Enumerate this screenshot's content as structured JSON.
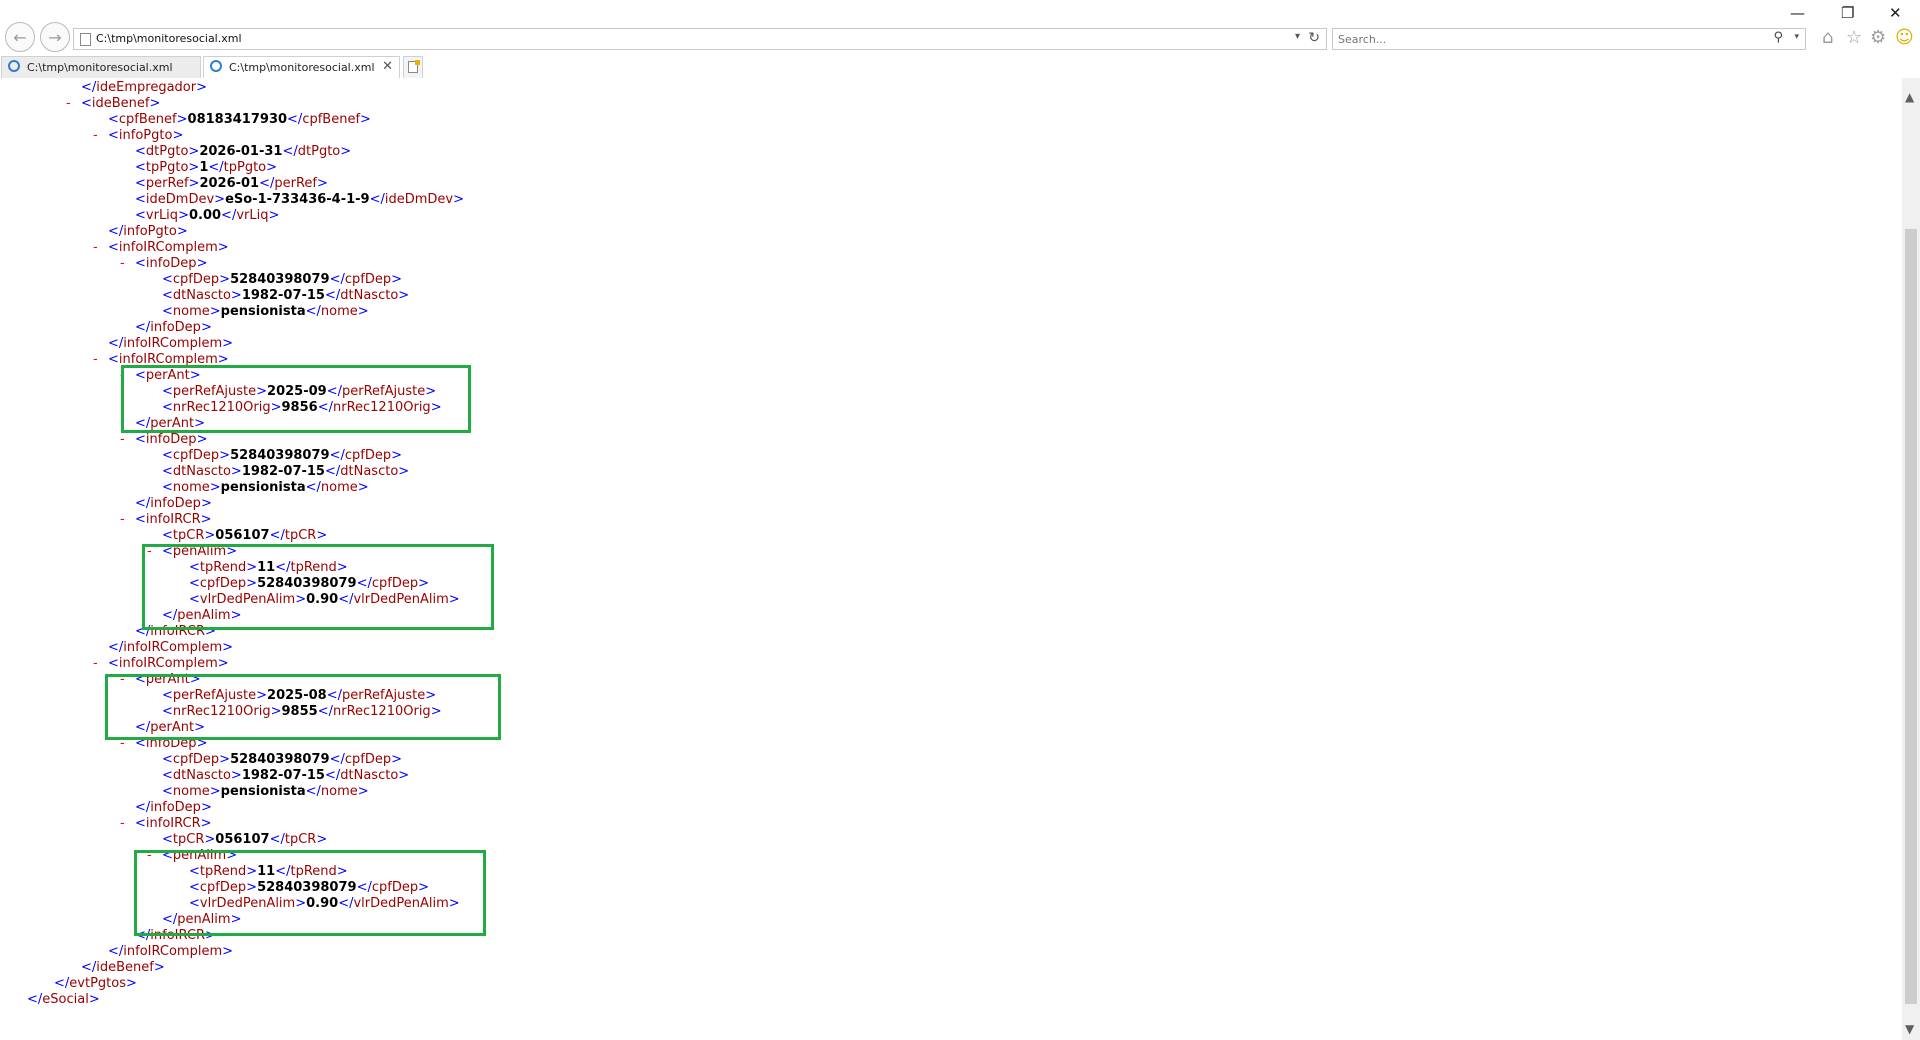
{
  "window": {
    "address": "C:\\tmp\\monitoresocial.xml",
    "search_placeholder": "Search...",
    "tabs": [
      {
        "label": "C:\\tmp\\monitoresocial.xml",
        "active": false
      },
      {
        "label": "C:\\tmp\\monitoresocial.xml",
        "active": true
      }
    ],
    "controls": {
      "close": "✕",
      "restore": "❐",
      "minimize": "—"
    },
    "icons": [
      "back-icon",
      "forward-icon",
      "refresh-icon",
      "search-icon",
      "home-icon",
      "star-icon",
      "gear-icon",
      "smiley-icon"
    ]
  },
  "xml_lines": [
    {
      "depth": 3,
      "kind": "close",
      "tag": "ideEmpregador"
    },
    {
      "depth": 3,
      "kind": "open",
      "tag": "ideBenef",
      "minus": true
    },
    {
      "depth": 4,
      "kind": "leaf",
      "tag": "cpfBenef",
      "value": "08183417930"
    },
    {
      "depth": 4,
      "kind": "open",
      "tag": "infoPgto",
      "minus": true
    },
    {
      "depth": 5,
      "kind": "leaf",
      "tag": "dtPgto",
      "value": "2026-01-31"
    },
    {
      "depth": 5,
      "kind": "leaf",
      "tag": "tpPgto",
      "value": "1"
    },
    {
      "depth": 5,
      "kind": "leaf",
      "tag": "perRef",
      "value": "2026-01"
    },
    {
      "depth": 5,
      "kind": "leaf",
      "tag": "ideDmDev",
      "value": "eSo-1-733436-4-1-9"
    },
    {
      "depth": 5,
      "kind": "leaf",
      "tag": "vrLiq",
      "value": "0.00"
    },
    {
      "depth": 4,
      "kind": "close",
      "tag": "infoPgto"
    },
    {
      "depth": 4,
      "kind": "open",
      "tag": "infoIRComplem",
      "minus": true
    },
    {
      "depth": 5,
      "kind": "open",
      "tag": "infoDep",
      "minus": true
    },
    {
      "depth": 6,
      "kind": "leaf",
      "tag": "cpfDep",
      "value": "52840398079"
    },
    {
      "depth": 6,
      "kind": "leaf",
      "tag": "dtNascto",
      "value": "1982-07-15"
    },
    {
      "depth": 6,
      "kind": "leaf",
      "tag": "nome",
      "value": "pensionista"
    },
    {
      "depth": 5,
      "kind": "close",
      "tag": "infoDep"
    },
    {
      "depth": 4,
      "kind": "close",
      "tag": "infoIRComplem"
    },
    {
      "depth": 4,
      "kind": "open",
      "tag": "infoIRComplem",
      "minus": true
    },
    {
      "depth": 5,
      "kind": "open",
      "tag": "perAnt",
      "minus": true
    },
    {
      "depth": 6,
      "kind": "leaf",
      "tag": "perRefAjuste",
      "value": "2025-09"
    },
    {
      "depth": 6,
      "kind": "leaf",
      "tag": "nrRec1210Orig",
      "value": "9856"
    },
    {
      "depth": 5,
      "kind": "close",
      "tag": "perAnt"
    },
    {
      "depth": 5,
      "kind": "open",
      "tag": "infoDep",
      "minus": true
    },
    {
      "depth": 6,
      "kind": "leaf",
      "tag": "cpfDep",
      "value": "52840398079"
    },
    {
      "depth": 6,
      "kind": "leaf",
      "tag": "dtNascto",
      "value": "1982-07-15"
    },
    {
      "depth": 6,
      "kind": "leaf",
      "tag": "nome",
      "value": "pensionista"
    },
    {
      "depth": 5,
      "kind": "close",
      "tag": "infoDep"
    },
    {
      "depth": 5,
      "kind": "open",
      "tag": "infoIRCR",
      "minus": true
    },
    {
      "depth": 6,
      "kind": "leaf",
      "tag": "tpCR",
      "value": "056107"
    },
    {
      "depth": 6,
      "kind": "open",
      "tag": "penAlim",
      "minus": true
    },
    {
      "depth": 7,
      "kind": "leaf",
      "tag": "tpRend",
      "value": "11"
    },
    {
      "depth": 7,
      "kind": "leaf",
      "tag": "cpfDep",
      "value": "52840398079"
    },
    {
      "depth": 7,
      "kind": "leaf",
      "tag": "vlrDedPenAlim",
      "value": "0.90"
    },
    {
      "depth": 6,
      "kind": "close",
      "tag": "penAlim"
    },
    {
      "depth": 5,
      "kind": "close",
      "tag": "infoIRCR"
    },
    {
      "depth": 4,
      "kind": "close",
      "tag": "infoIRComplem"
    },
    {
      "depth": 4,
      "kind": "open",
      "tag": "infoIRComplem",
      "minus": true
    },
    {
      "depth": 5,
      "kind": "open",
      "tag": "perAnt",
      "minus": true
    },
    {
      "depth": 6,
      "kind": "leaf",
      "tag": "perRefAjuste",
      "value": "2025-08"
    },
    {
      "depth": 6,
      "kind": "leaf",
      "tag": "nrRec1210Orig",
      "value": "9855"
    },
    {
      "depth": 5,
      "kind": "close",
      "tag": "perAnt"
    },
    {
      "depth": 5,
      "kind": "open",
      "tag": "infoDep",
      "minus": true
    },
    {
      "depth": 6,
      "kind": "leaf",
      "tag": "cpfDep",
      "value": "52840398079"
    },
    {
      "depth": 6,
      "kind": "leaf",
      "tag": "dtNascto",
      "value": "1982-07-15"
    },
    {
      "depth": 6,
      "kind": "leaf",
      "tag": "nome",
      "value": "pensionista"
    },
    {
      "depth": 5,
      "kind": "close",
      "tag": "infoDep"
    },
    {
      "depth": 5,
      "kind": "open",
      "tag": "infoIRCR",
      "minus": true
    },
    {
      "depth": 6,
      "kind": "leaf",
      "tag": "tpCR",
      "value": "056107"
    },
    {
      "depth": 6,
      "kind": "open",
      "tag": "penAlim",
      "minus": true
    },
    {
      "depth": 7,
      "kind": "leaf",
      "tag": "tpRend",
      "value": "11"
    },
    {
      "depth": 7,
      "kind": "leaf",
      "tag": "cpfDep",
      "value": "52840398079"
    },
    {
      "depth": 7,
      "kind": "leaf",
      "tag": "vlrDedPenAlim",
      "value": "0.90"
    },
    {
      "depth": 6,
      "kind": "close",
      "tag": "penAlim"
    },
    {
      "depth": 5,
      "kind": "close",
      "tag": "infoIRCR"
    },
    {
      "depth": 4,
      "kind": "close",
      "tag": "infoIRComplem"
    },
    {
      "depth": 3,
      "kind": "close",
      "tag": "ideBenef"
    },
    {
      "depth": 2,
      "kind": "close",
      "tag": "evtPgtos"
    },
    {
      "depth": 1,
      "kind": "close",
      "tag": "eSocial"
    }
  ],
  "highlight_color": "#22aa44"
}
